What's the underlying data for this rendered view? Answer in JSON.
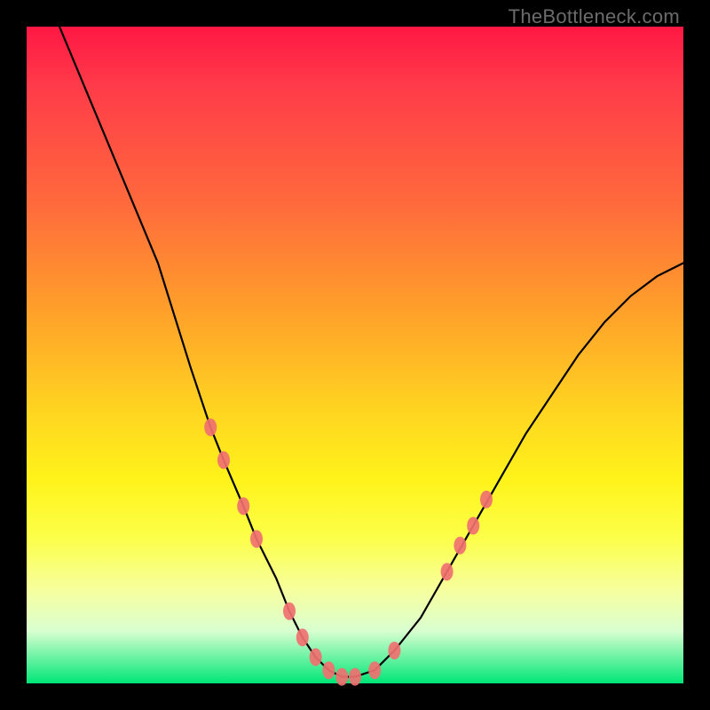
{
  "watermark_text": "TheBottleneck.com",
  "chart_data": {
    "type": "line",
    "title": "",
    "xlabel": "",
    "ylabel": "",
    "xlim": [
      0,
      100
    ],
    "ylim": [
      0,
      100
    ],
    "grid": false,
    "legend": false,
    "series": [
      {
        "name": "bottleneck-curve",
        "x": [
          5,
          10,
          15,
          20,
          25,
          28,
          30,
          33,
          35,
          38,
          40,
          42,
          44,
          46,
          48,
          50,
          53,
          56,
          60,
          64,
          68,
          72,
          76,
          80,
          84,
          88,
          92,
          96,
          100
        ],
        "values": [
          100,
          88,
          76,
          64,
          48,
          39,
          34,
          27,
          22,
          16,
          11,
          7,
          4,
          2,
          1,
          1,
          2,
          5,
          10,
          17,
          24,
          31,
          38,
          44,
          50,
          55,
          59,
          62,
          64
        ]
      }
    ],
    "markers": [
      {
        "x": 28,
        "y": 39
      },
      {
        "x": 30,
        "y": 34
      },
      {
        "x": 33,
        "y": 27
      },
      {
        "x": 35,
        "y": 22
      },
      {
        "x": 40,
        "y": 11
      },
      {
        "x": 42,
        "y": 7
      },
      {
        "x": 44,
        "y": 4
      },
      {
        "x": 46,
        "y": 2
      },
      {
        "x": 48,
        "y": 1
      },
      {
        "x": 50,
        "y": 1
      },
      {
        "x": 53,
        "y": 2
      },
      {
        "x": 56,
        "y": 5
      },
      {
        "x": 64,
        "y": 17
      },
      {
        "x": 66,
        "y": 21
      },
      {
        "x": 68,
        "y": 24
      },
      {
        "x": 70,
        "y": 28
      }
    ]
  }
}
